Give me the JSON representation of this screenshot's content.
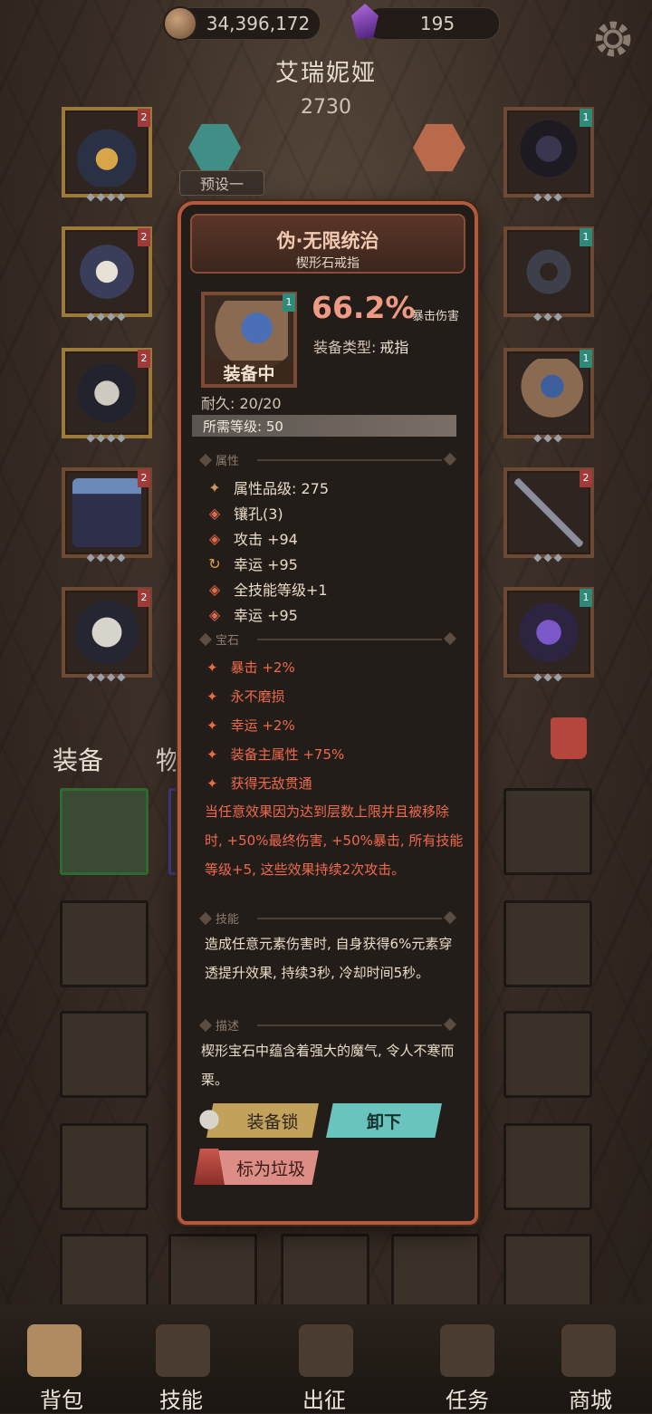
{
  "top": {
    "gold": "34,396,172",
    "gems": "195"
  },
  "hero": {
    "name": "艾瑞妮娅",
    "power": "2730",
    "preset": "预设一"
  },
  "equip_slots_left": [
    {
      "name": "helmet-slot",
      "tier": "2",
      "frame": "gold"
    },
    {
      "name": "necklace-slot",
      "tier": "2",
      "frame": "gold"
    },
    {
      "name": "chest-slot",
      "tier": "2",
      "frame": "gold"
    },
    {
      "name": "belt-slot",
      "tier": "2",
      "frame": "brown"
    },
    {
      "name": "boots-slot",
      "tier": "2",
      "frame": "brown"
    }
  ],
  "equip_slots_right": [
    {
      "name": "amulet-slot",
      "tier": "1"
    },
    {
      "name": "ring-slot",
      "tier": "1"
    },
    {
      "name": "ring-slot-2",
      "tier": "1"
    },
    {
      "name": "weapon-slot",
      "tier": "2"
    },
    {
      "name": "offhand-slot",
      "tier": "1"
    }
  ],
  "tabs": {
    "equipment": "装备",
    "items": "物品"
  },
  "item": {
    "name": "伪·无限统治",
    "type_name": "楔形石戒指",
    "tier": "1",
    "equipped_label": "装备中",
    "main_value": "66.2%",
    "main_label": "暴击伤害",
    "equip_type_label": "装备类型:",
    "equip_type": "戒指",
    "durability": "耐久: 20/20",
    "required_level": "所需等级: 50",
    "section_attr": "属性",
    "attributes": [
      {
        "icon": "quality-icon",
        "text": "属性品级: 275"
      },
      {
        "icon": "socket-icon",
        "text": "镶孔(3)"
      },
      {
        "icon": "attack-icon",
        "text": "攻击 +94"
      },
      {
        "icon": "luck-icon",
        "text": "幸运 +95"
      },
      {
        "icon": "skill-icon",
        "text": "全技能等级+1"
      },
      {
        "icon": "luck-icon",
        "text": "幸运 +95"
      }
    ],
    "section_gem": "宝石",
    "gems": [
      "暴击 +2%",
      "永不磨损",
      "幸运 +2%",
      "装备主属性 +75%",
      "获得无敌贯通"
    ],
    "gem_effect": "当任意效果因为达到层数上限并且被移除时, +50%最终伤害, +50%暴击, 所有技能等级+5, 这些效果持续2次攻击。",
    "section_skill": "技能",
    "skill": "造成任意元素伤害时, 自身获得6%元素穿透提升效果, 持续3秒, 冷却时间5秒。",
    "section_desc": "描述",
    "description": "楔形宝石中蕴含着强大的魔气, 令人不寒而栗。",
    "btn_lock": "装备锁",
    "btn_unequip": "卸下",
    "btn_junk": "标为垃圾"
  },
  "nav": {
    "bag": "背包",
    "skills": "技能",
    "expedition": "出征",
    "quests": "任务",
    "shop": "商城"
  },
  "colors": {
    "panel_border": "#b45a3c",
    "accent_red": "#ef6a4d",
    "teal": "#68c4bc",
    "gold": "#c2a25a"
  }
}
